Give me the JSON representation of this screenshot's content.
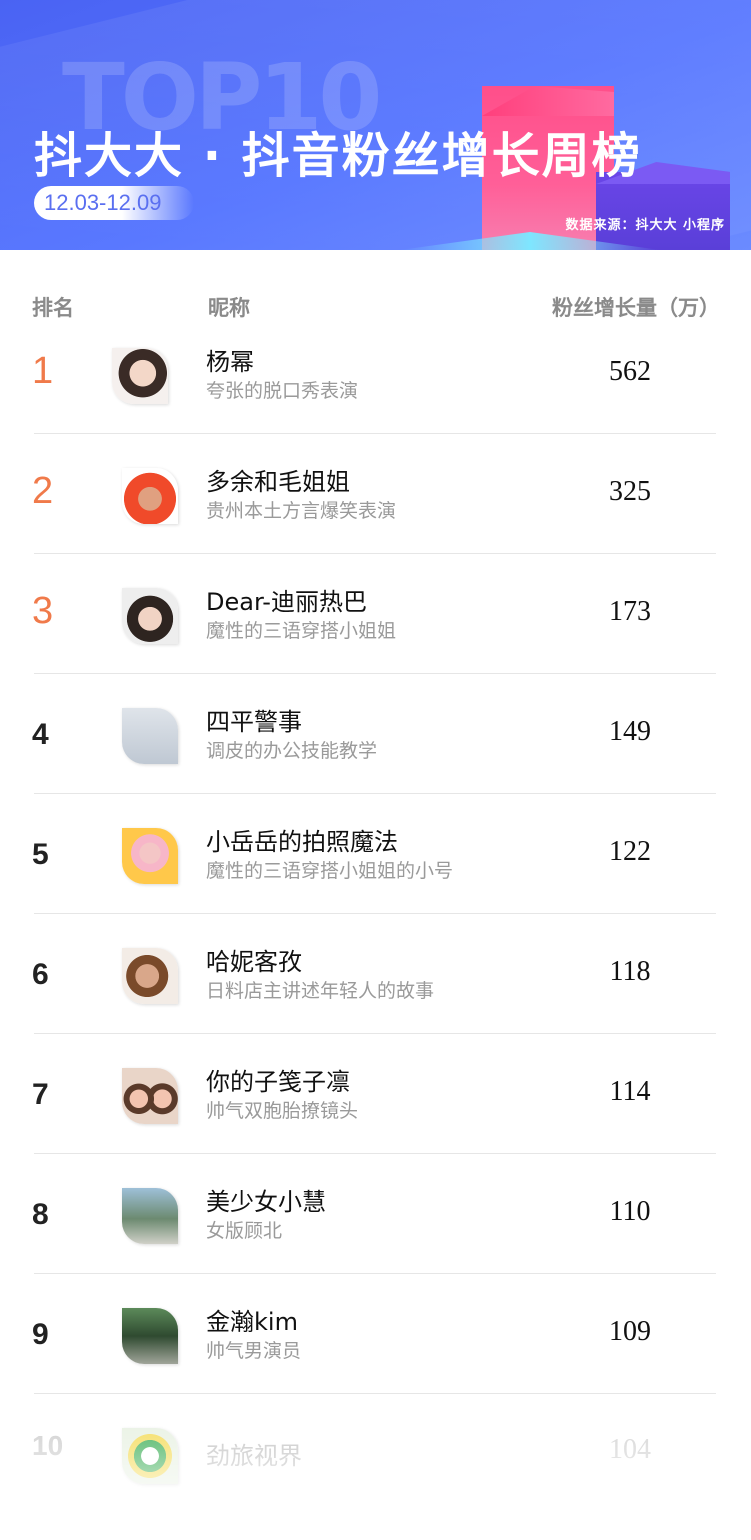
{
  "header": {
    "watermark": "TOP10",
    "title": "抖大大 · 抖音粉丝增长周榜",
    "date_range": "12.03-12.09",
    "source": "数据来源：抖大大 小程序"
  },
  "columns": {
    "rank": "排名",
    "nickname": "昵称",
    "growth": "粉丝增长量（万）"
  },
  "rows": [
    {
      "rank": "1",
      "name": "杨幂",
      "desc": "夸张的脱口秀表演",
      "value": "562",
      "avatar": "avatar-1"
    },
    {
      "rank": "2",
      "name": "多余和毛姐姐",
      "desc": "贵州本土方言爆笑表演",
      "value": "325",
      "avatar": "avatar-2"
    },
    {
      "rank": "3",
      "name": "Dear-迪丽热巴",
      "desc": "魔性的三语穿搭小姐姐",
      "value": "173",
      "avatar": "avatar-3"
    },
    {
      "rank": "4",
      "name": "四平警事",
      "desc": "调皮的办公技能教学",
      "value": "149",
      "avatar": "avatar-4"
    },
    {
      "rank": "5",
      "name": "小岳岳的拍照魔法",
      "desc": "魔性的三语穿搭小姐姐的小号",
      "value": "122",
      "avatar": "avatar-5"
    },
    {
      "rank": "6",
      "name": "哈妮客孜",
      "desc": "日料店主讲述年轻人的故事",
      "value": "118",
      "avatar": "avatar-6"
    },
    {
      "rank": "7",
      "name": "你的子笺子凛",
      "desc": "帅气双胞胎撩镜头",
      "value": "114",
      "avatar": "avatar-7"
    },
    {
      "rank": "8",
      "name": "美少女小慧",
      "desc": "女版顾北",
      "value": "110",
      "avatar": "avatar-8"
    },
    {
      "rank": "9",
      "name": "金瀚kim",
      "desc": "帅气男演员",
      "value": "109",
      "avatar": "avatar-9"
    },
    {
      "rank": "10",
      "name": "劲旅视界",
      "desc": "",
      "value": "104",
      "avatar": "avatar-10"
    }
  ],
  "colors": {
    "banner": "#5474ff",
    "top_rank": "#f07a4a",
    "text": "#111111",
    "muted": "#9a9a9a"
  }
}
